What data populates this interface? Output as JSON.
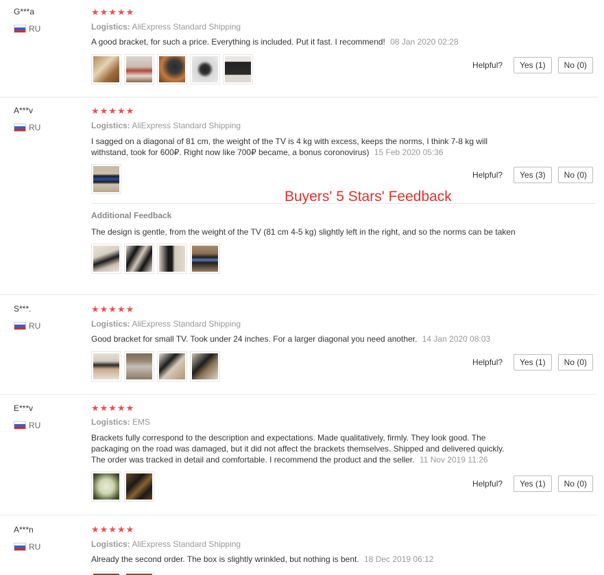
{
  "labels": {
    "logistics": "Logistics:",
    "helpful": "Helpful?",
    "additional_feedback": "Additional Feedback"
  },
  "overlay_text": "Buyers' 5 Stars' Feedback",
  "reviews": [
    {
      "user": "G***a",
      "country": "RU",
      "stars": "★★★★★",
      "logistics": "AliExpress Standard Shipping",
      "text": "A good bracket, for such a price. Everything is included. Put it fast. I recommend!",
      "date": "08 Jan 2020 02:28",
      "yes": "Yes (1)",
      "no": "No (0)"
    },
    {
      "user": "A***v",
      "country": "RU",
      "stars": "★★★★★",
      "logistics": "AliExpress Standard Shipping",
      "text": "I sagged on a diagonal of 81 cm, the weight of the TV is 4 kg with excess, keeps the norms, I think 7-8 kg will withstand, took for 600₽. Right now like 700₽ became, a bonus coronovirus)",
      "date": "15 Feb 2020 05:36",
      "yes": "Yes (3)",
      "no": "No (0)",
      "additional_text": "The design is gentle, from the weight of the TV (81 cm 4-5 kg) slightly left in the right, and so the norms can be taken"
    },
    {
      "user": "S***.",
      "country": "RU",
      "stars": "★★★★★",
      "logistics": "AliExpress Standard Shipping",
      "text": "Good bracket for small TV. Took under 24 inches. For a larger diagonal you need another.",
      "date": "14 Jan 2020 08:03",
      "yes": "Yes (1)",
      "no": "No (0)"
    },
    {
      "user": "E***v",
      "country": "RU",
      "stars": "★★★★★",
      "logistics": "EMS",
      "text": "Brackets fully correspond to the description and expectations. Made qualitatively, firmly. They look good. The packaging on the road was damaged, but it did not affect the brackets themselves. Shipped and delivered quickly. The order was tracked in detail and comfortable. I recommend the product and the seller.",
      "date": "11 Nov 2019 11:26",
      "yes": "Yes (1)",
      "no": "No (0)"
    },
    {
      "user": "A***n",
      "country": "RU",
      "stars": "★★★★★",
      "logistics": "AliExpress Standard Shipping",
      "text": "Already the second order. The box is slightly wrinkled, but nothing is bent.",
      "date": "18 Dec 2019 06:12"
    }
  ]
}
